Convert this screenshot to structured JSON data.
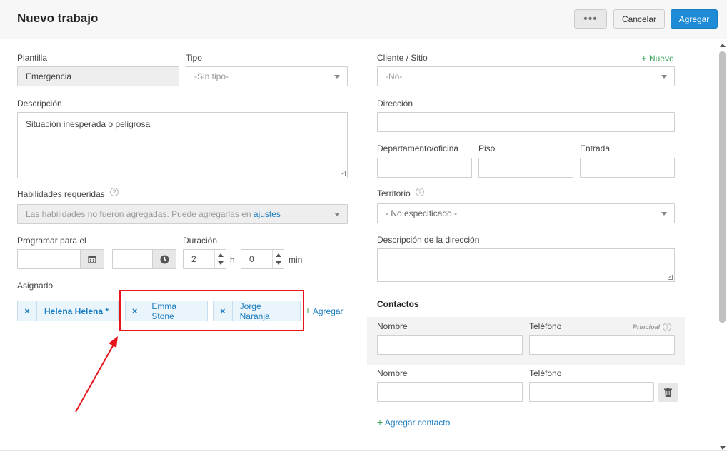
{
  "header": {
    "title": "Nuevo trabajo",
    "more_label": "•••",
    "cancel_label": "Cancelar",
    "add_label": "Agregar"
  },
  "left": {
    "plantilla": {
      "label": "Plantilla",
      "value": "Emergencia"
    },
    "tipo": {
      "label": "Tipo",
      "value": "-Sin tipo-"
    },
    "descripcion": {
      "label": "Descripción",
      "value": "Situación inesperada o peligrosa"
    },
    "habilidades": {
      "label": "Habilidades requeridas",
      "help": "?",
      "text": "Las habilidades no fueron agregadas. Puede agregarlas en ",
      "link": "ajustes"
    },
    "programar": {
      "label": "Programar para el",
      "date_value": "",
      "time_value": ""
    },
    "duracion": {
      "label": "Duración",
      "hours": "2",
      "hours_unit": "h",
      "minutes": "0",
      "minutes_unit": "min"
    },
    "asignado": {
      "label": "Asignado",
      "chips": [
        {
          "remove": "×",
          "name": "Helena Helena *"
        },
        {
          "remove": "×",
          "name": "Emma Stone"
        },
        {
          "remove": "×",
          "name": "Jorge Naranja"
        }
      ],
      "add_icon": "+",
      "add_label": "Agregar"
    }
  },
  "right": {
    "cliente": {
      "label": "Cliente / Sitio",
      "new_icon": "+",
      "new_label": "Nuevo",
      "value": "-No-"
    },
    "direccion": {
      "label": "Dirección",
      "value": ""
    },
    "departamento": {
      "label": "Departamento/oficina",
      "value": ""
    },
    "piso": {
      "label": "Piso",
      "value": ""
    },
    "entrada": {
      "label": "Entrada",
      "value": ""
    },
    "territorio": {
      "label": "Territorio",
      "help": "?",
      "value": "- No especificado -"
    },
    "descripcion_direccion": {
      "label": "Descripción de la dirección",
      "value": ""
    },
    "contactos": {
      "title": "Contactos",
      "principal": "Principal",
      "principal_help": "?",
      "rows": [
        {
          "name_label": "Nombre",
          "phone_label": "Teléfono",
          "name": "",
          "phone": ""
        },
        {
          "name_label": "Nombre",
          "phone_label": "Teléfono",
          "name": "",
          "phone": ""
        }
      ],
      "add_icon": "+",
      "add_label": "Agregar contacto"
    }
  },
  "annotation": {
    "color": "#e8141b"
  },
  "colors": {
    "accent": "#1f8bd6",
    "link": "#1a7cc0",
    "add_green": "#3aa35a"
  },
  "icons": [
    "calendar-icon",
    "clock-icon",
    "trash-icon",
    "close-icon",
    "plus-icon",
    "help-icon",
    "chevron-down-icon"
  ]
}
